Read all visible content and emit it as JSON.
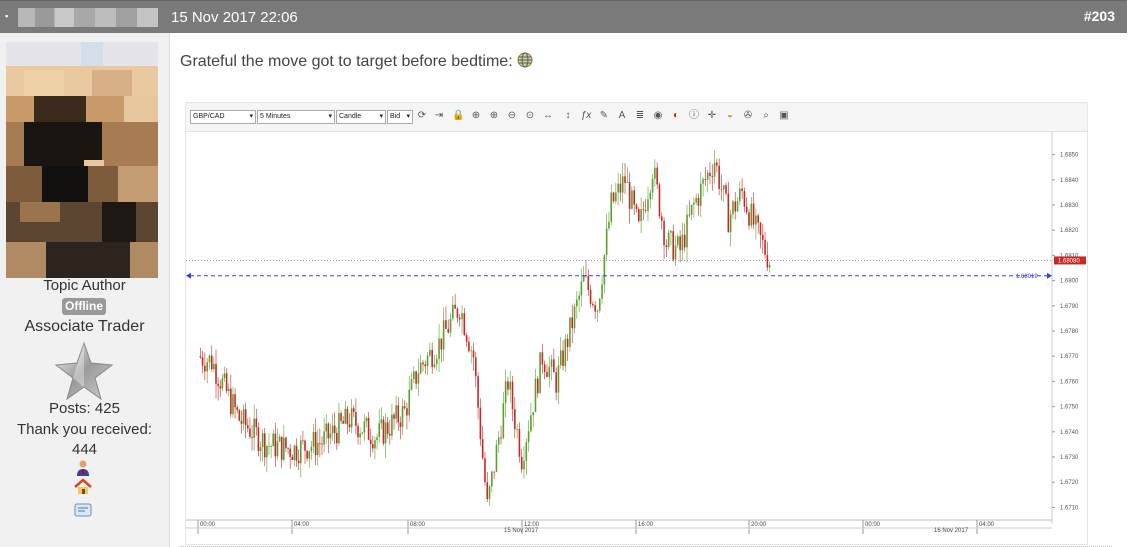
{
  "header": {
    "date": "15 Nov 2017 22:06",
    "post_number": "#203"
  },
  "author": {
    "role": "Topic Author",
    "status_badge": "Offline",
    "rank": "Associate Trader",
    "posts": "Posts: 425",
    "thanks_label": "Thank you received:",
    "thanks_count": "444"
  },
  "post": {
    "text": "Grateful the move got to target before bedtime:"
  },
  "toolbar": {
    "symbol": "GBP/CAD",
    "timeframe": "5 Minutes",
    "chart_type": "Candle",
    "price_side": "Bid"
  },
  "chart_data": {
    "type": "candlestick",
    "symbol": "GBP/CAD",
    "interval": "5 Minutes",
    "x_ticks": [
      "00:00",
      "04:00",
      "08:00",
      "12:00",
      "16:00",
      "20:00",
      "00:00",
      "04:00"
    ],
    "x_date_labels": [
      "15 Nov 2017",
      "16 Nov 2017"
    ],
    "y_ticks": [
      "1.6850",
      "1.6840",
      "1.6830",
      "1.6820",
      "1.6810",
      "1.6800",
      "1.6790",
      "1.6780",
      "1.6770",
      "1.6760",
      "1.6750",
      "1.6740",
      "1.6730",
      "1.6720",
      "1.6710"
    ],
    "ylim": [
      1.6705,
      1.6855
    ],
    "current_price_label": "1.68080",
    "target_price_label": "1.68019",
    "target_price": 1.68019,
    "current_price": 1.6808,
    "up_color": "#5aa02c",
    "down_color": "#c62828",
    "path_points": [
      [
        "00:00",
        1.677
      ],
      [
        "00:30",
        1.6768
      ],
      [
        "01:30",
        1.6745
      ],
      [
        "02:30",
        1.6735
      ],
      [
        "03:30",
        1.6733
      ],
      [
        "04:30",
        1.6736
      ],
      [
        "05:30",
        1.6745
      ],
      [
        "06:30",
        1.6738
      ],
      [
        "07:30",
        1.6748
      ],
      [
        "08:00",
        1.6765
      ],
      [
        "08:45",
        1.6775
      ],
      [
        "09:30",
        1.679
      ],
      [
        "10:00",
        1.677
      ],
      [
        "10:30",
        1.671
      ],
      [
        "11:15",
        1.676
      ],
      [
        "11:45",
        1.673
      ],
      [
        "12:30",
        1.677
      ],
      [
        "13:00",
        1.676
      ],
      [
        "13:30",
        1.678
      ],
      [
        "14:00",
        1.68
      ],
      [
        "14:30",
        1.679
      ],
      [
        "15:00",
        1.683
      ],
      [
        "15:30",
        1.684
      ],
      [
        "16:00",
        1.682
      ],
      [
        "16:30",
        1.6845
      ],
      [
        "17:00",
        1.6815
      ],
      [
        "17:30",
        1.6812
      ],
      [
        "18:00",
        1.683
      ],
      [
        "18:45",
        1.6848
      ],
      [
        "19:15",
        1.6825
      ],
      [
        "19:45",
        1.6835
      ],
      [
        "20:15",
        1.682
      ],
      [
        "20:45",
        1.6808
      ]
    ]
  }
}
